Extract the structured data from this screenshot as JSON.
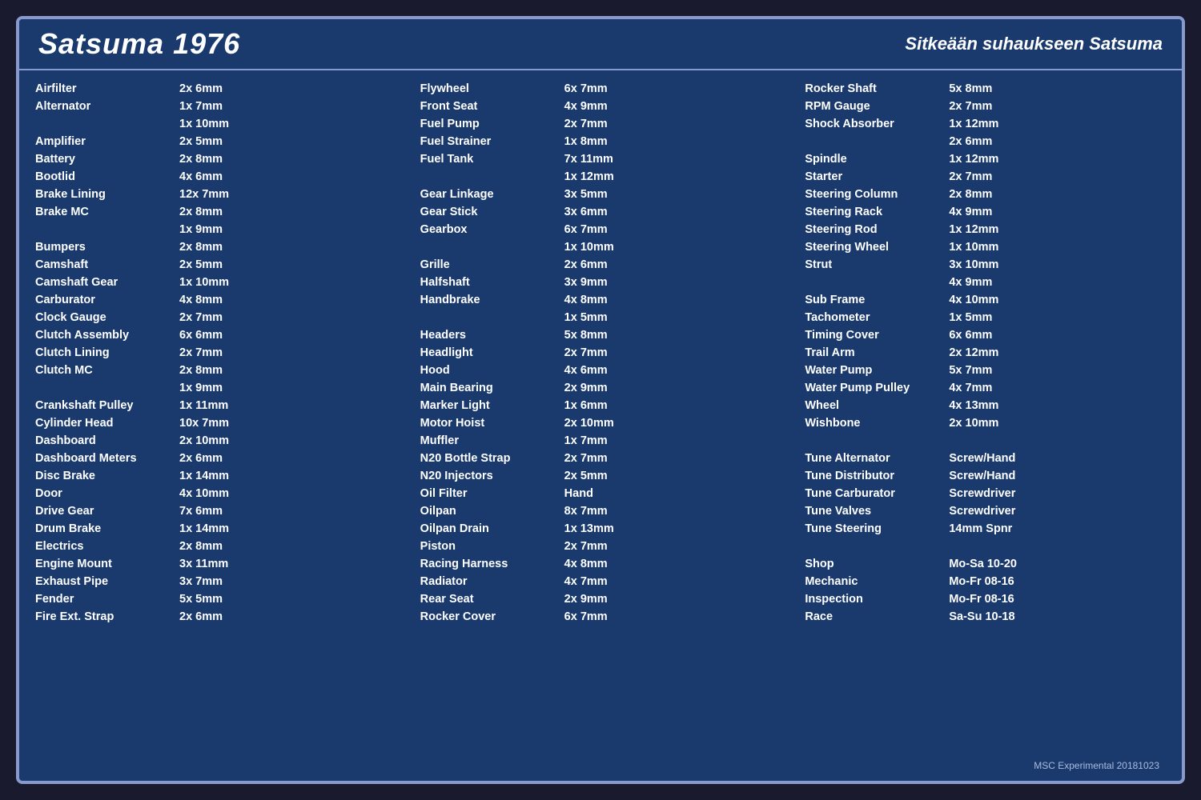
{
  "header": {
    "title": "Satsuma 1976",
    "subtitle": "Sitkeään suhaukseen Satsuma"
  },
  "footer": {
    "text": "MSC Experimental 20181023"
  },
  "col1": [
    {
      "name": "Airfilter",
      "spec": "2x 6mm"
    },
    {
      "name": "Alternator",
      "spec": "1x 7mm"
    },
    {
      "name": "",
      "spec": "1x 10mm"
    },
    {
      "name": "Amplifier",
      "spec": "2x 5mm"
    },
    {
      "name": "Battery",
      "spec": "2x 8mm"
    },
    {
      "name": "Bootlid",
      "spec": "4x 6mm"
    },
    {
      "name": "Brake Lining",
      "spec": "12x 7mm"
    },
    {
      "name": "Brake MC",
      "spec": "2x 8mm"
    },
    {
      "name": "",
      "spec": "1x 9mm"
    },
    {
      "name": "Bumpers",
      "spec": "2x 8mm"
    },
    {
      "name": "Camshaft",
      "spec": "2x 5mm"
    },
    {
      "name": "Camshaft Gear",
      "spec": "1x 10mm"
    },
    {
      "name": "Carburator",
      "spec": "4x 8mm"
    },
    {
      "name": "Clock Gauge",
      "spec": "2x 7mm"
    },
    {
      "name": "Clutch Assembly",
      "spec": "6x 6mm"
    },
    {
      "name": "Clutch Lining",
      "spec": "2x 7mm"
    },
    {
      "name": "Clutch MC",
      "spec": "2x 8mm"
    },
    {
      "name": "",
      "spec": "1x 9mm"
    },
    {
      "name": "Crankshaft Pulley",
      "spec": "1x 11mm"
    },
    {
      "name": "Cylinder Head",
      "spec": "10x 7mm"
    },
    {
      "name": "Dashboard",
      "spec": "2x 10mm"
    },
    {
      "name": "Dashboard Meters",
      "spec": "2x 6mm"
    },
    {
      "name": "Disc Brake",
      "spec": "1x 14mm"
    },
    {
      "name": "Door",
      "spec": "4x 10mm"
    },
    {
      "name": "Drive Gear",
      "spec": "7x 6mm"
    },
    {
      "name": "Drum Brake",
      "spec": "1x 14mm"
    },
    {
      "name": "Electrics",
      "spec": "2x 8mm"
    },
    {
      "name": "Engine Mount",
      "spec": "3x 11mm"
    },
    {
      "name": "Exhaust Pipe",
      "spec": "3x 7mm"
    },
    {
      "name": "Fender",
      "spec": "5x 5mm"
    },
    {
      "name": "Fire Ext. Strap",
      "spec": "2x 6mm"
    }
  ],
  "col2": [
    {
      "name": "Flywheel",
      "spec": "6x 7mm"
    },
    {
      "name": "Front Seat",
      "spec": "4x 9mm"
    },
    {
      "name": "Fuel Pump",
      "spec": "2x 7mm"
    },
    {
      "name": "Fuel Strainer",
      "spec": "1x 8mm"
    },
    {
      "name": "Fuel Tank",
      "spec": "7x 11mm"
    },
    {
      "name": "",
      "spec": "1x 12mm"
    },
    {
      "name": "Gear Linkage",
      "spec": "3x 5mm"
    },
    {
      "name": "Gear Stick",
      "spec": "3x 6mm"
    },
    {
      "name": "Gearbox",
      "spec": "6x 7mm"
    },
    {
      "name": "",
      "spec": "1x 10mm"
    },
    {
      "name": "Grille",
      "spec": "2x 6mm"
    },
    {
      "name": "Halfshaft",
      "spec": "3x 9mm"
    },
    {
      "name": "Handbrake",
      "spec": "4x 8mm"
    },
    {
      "name": "",
      "spec": "1x 5mm"
    },
    {
      "name": "Headers",
      "spec": "5x 8mm"
    },
    {
      "name": "Headlight",
      "spec": "2x 7mm"
    },
    {
      "name": "Hood",
      "spec": "4x 6mm"
    },
    {
      "name": "Main Bearing",
      "spec": "2x 9mm"
    },
    {
      "name": "Marker Light",
      "spec": "1x 6mm"
    },
    {
      "name": "Motor Hoist",
      "spec": "2x 10mm"
    },
    {
      "name": "Muffler",
      "spec": "1x 7mm"
    },
    {
      "name": "N20 Bottle Strap",
      "spec": "2x 7mm"
    },
    {
      "name": "N20 Injectors",
      "spec": "2x 5mm"
    },
    {
      "name": "Oil Filter",
      "spec": "Hand"
    },
    {
      "name": "Oilpan",
      "spec": "8x 7mm"
    },
    {
      "name": "Oilpan Drain",
      "spec": "1x 13mm"
    },
    {
      "name": "Piston",
      "spec": "2x 7mm"
    },
    {
      "name": "Racing Harness",
      "spec": "4x 8mm"
    },
    {
      "name": "Radiator",
      "spec": "4x 7mm"
    },
    {
      "name": "Rear Seat",
      "spec": "2x 9mm"
    },
    {
      "name": "Rocker Cover",
      "spec": "6x 7mm"
    }
  ],
  "col3": [
    {
      "name": "Rocker Shaft",
      "spec": "5x 8mm"
    },
    {
      "name": "RPM Gauge",
      "spec": "2x 7mm"
    },
    {
      "name": "Shock Absorber",
      "spec": "1x 12mm"
    },
    {
      "name": "",
      "spec": "2x 6mm"
    },
    {
      "name": "Spindle",
      "spec": "1x 12mm"
    },
    {
      "name": "Starter",
      "spec": "2x 7mm"
    },
    {
      "name": "Steering Column",
      "spec": "2x 8mm"
    },
    {
      "name": "Steering Rack",
      "spec": "4x 9mm"
    },
    {
      "name": "Steering Rod",
      "spec": "1x 12mm"
    },
    {
      "name": "Steering Wheel",
      "spec": "1x 10mm"
    },
    {
      "name": "Strut",
      "spec": "3x 10mm"
    },
    {
      "name": "",
      "spec": "4x 9mm"
    },
    {
      "name": "Sub Frame",
      "spec": "4x 10mm"
    },
    {
      "name": "Tachometer",
      "spec": "1x 5mm"
    },
    {
      "name": "Timing Cover",
      "spec": "6x 6mm"
    },
    {
      "name": "Trail Arm",
      "spec": "2x 12mm"
    },
    {
      "name": "Water Pump",
      "spec": "5x 7mm"
    },
    {
      "name": "Water Pump Pulley",
      "spec": "4x 7mm"
    },
    {
      "name": "Wheel",
      "spec": "4x 13mm"
    },
    {
      "name": "Wishbone",
      "spec": "2x 10mm"
    },
    {
      "name": "",
      "spec": ""
    },
    {
      "name": "Tune Alternator",
      "spec": "Screw/Hand"
    },
    {
      "name": "Tune Distributor",
      "spec": "Screw/Hand"
    },
    {
      "name": "Tune Carburator",
      "spec": "Screwdriver"
    },
    {
      "name": "Tune Valves",
      "spec": "Screwdriver"
    },
    {
      "name": "Tune Steering",
      "spec": "14mm Spnr"
    },
    {
      "name": "",
      "spec": ""
    },
    {
      "name": "Shop",
      "spec": "Mo-Sa 10-20"
    },
    {
      "name": "Mechanic",
      "spec": "Mo-Fr 08-16"
    },
    {
      "name": "Inspection",
      "spec": "Mo-Fr 08-16"
    },
    {
      "name": "Race",
      "spec": "Sa-Su 10-18"
    }
  ]
}
